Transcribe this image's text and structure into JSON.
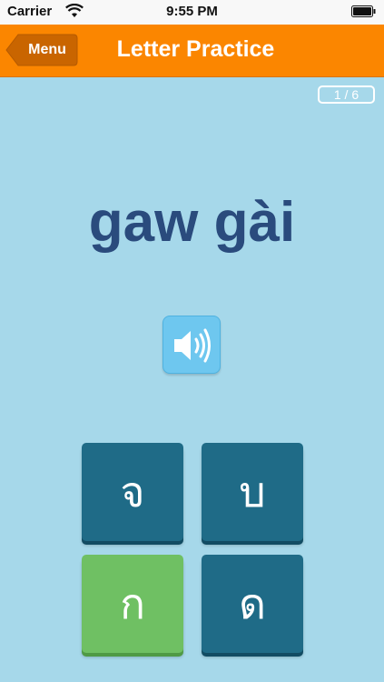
{
  "status_bar": {
    "carrier": "Carrier",
    "time": "9:55 PM"
  },
  "nav": {
    "back_label": "Menu",
    "title": "Letter Practice",
    "accent_color": "#fb8600"
  },
  "progress": {
    "label": "1 / 6",
    "current": 1,
    "total": 6
  },
  "prompt": {
    "romanization": "gaw gài",
    "sound_icon": "speaker-icon"
  },
  "answers": [
    {
      "letter": "จ",
      "state": "default"
    },
    {
      "letter": "บ",
      "state": "default"
    },
    {
      "letter": "ก",
      "state": "correct"
    },
    {
      "letter": "ด",
      "state": "default"
    }
  ],
  "colors": {
    "background": "#a6d8ea",
    "tile_default": "#1f6b87",
    "tile_correct": "#6fc063",
    "text_primary": "#2a4b7d"
  }
}
